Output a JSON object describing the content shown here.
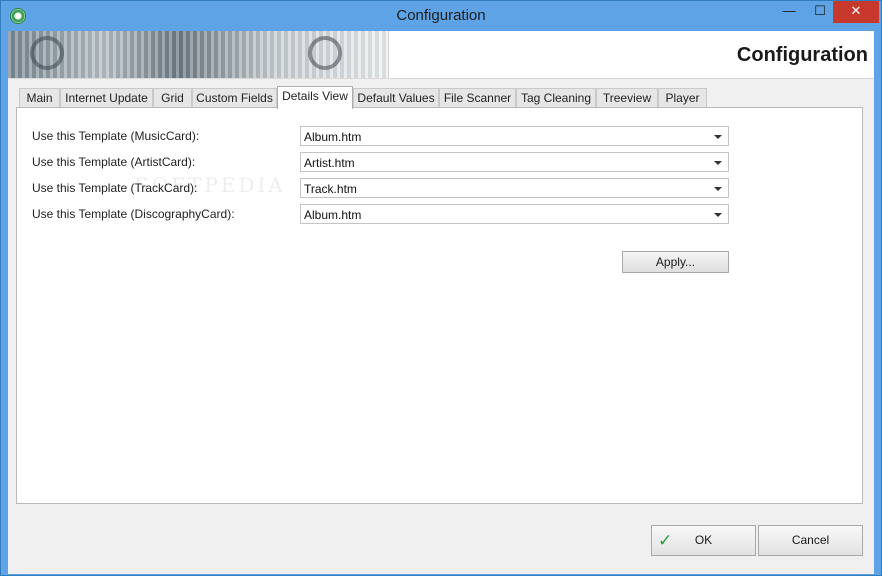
{
  "window": {
    "title": "Configuration",
    "icons": {
      "app": "app-icon",
      "minimize": "minimize-icon",
      "maximize": "maximize-icon",
      "close": "close-icon"
    },
    "caption_glyphs": {
      "minimize": "—",
      "maximize": "☐",
      "close": "✕"
    }
  },
  "header": {
    "title": "Configuration"
  },
  "tabs": [
    {
      "label": "Main"
    },
    {
      "label": "Internet Update"
    },
    {
      "label": "Grid"
    },
    {
      "label": "Custom Fields"
    },
    {
      "label": "Details View"
    },
    {
      "label": "Default Values"
    },
    {
      "label": "File Scanner"
    },
    {
      "label": "Tag Cleaning"
    },
    {
      "label": "Treeview"
    },
    {
      "label": "Player"
    }
  ],
  "active_tab": "Details View",
  "details_view": {
    "rows": [
      {
        "label": "Use this Template (MusicCard):",
        "value": "Album.htm"
      },
      {
        "label": "Use this Template (ArtistCard):",
        "value": "Artist.htm"
      },
      {
        "label": "Use this Template (TrackCard):",
        "value": "Track.htm"
      },
      {
        "label": "Use this Template (DiscographyCard):",
        "value": "Album.htm"
      }
    ],
    "apply_label": "Apply..."
  },
  "watermark": "SOFTPEDIA",
  "footer": {
    "ok_label": "OK",
    "cancel_label": "Cancel",
    "ok_icon": "checkmark-icon",
    "ok_glyph": "✓"
  },
  "colors": {
    "titlebar": "#5da3e6",
    "close_button": "#c7392c",
    "ok_check": "#2f9a36"
  }
}
